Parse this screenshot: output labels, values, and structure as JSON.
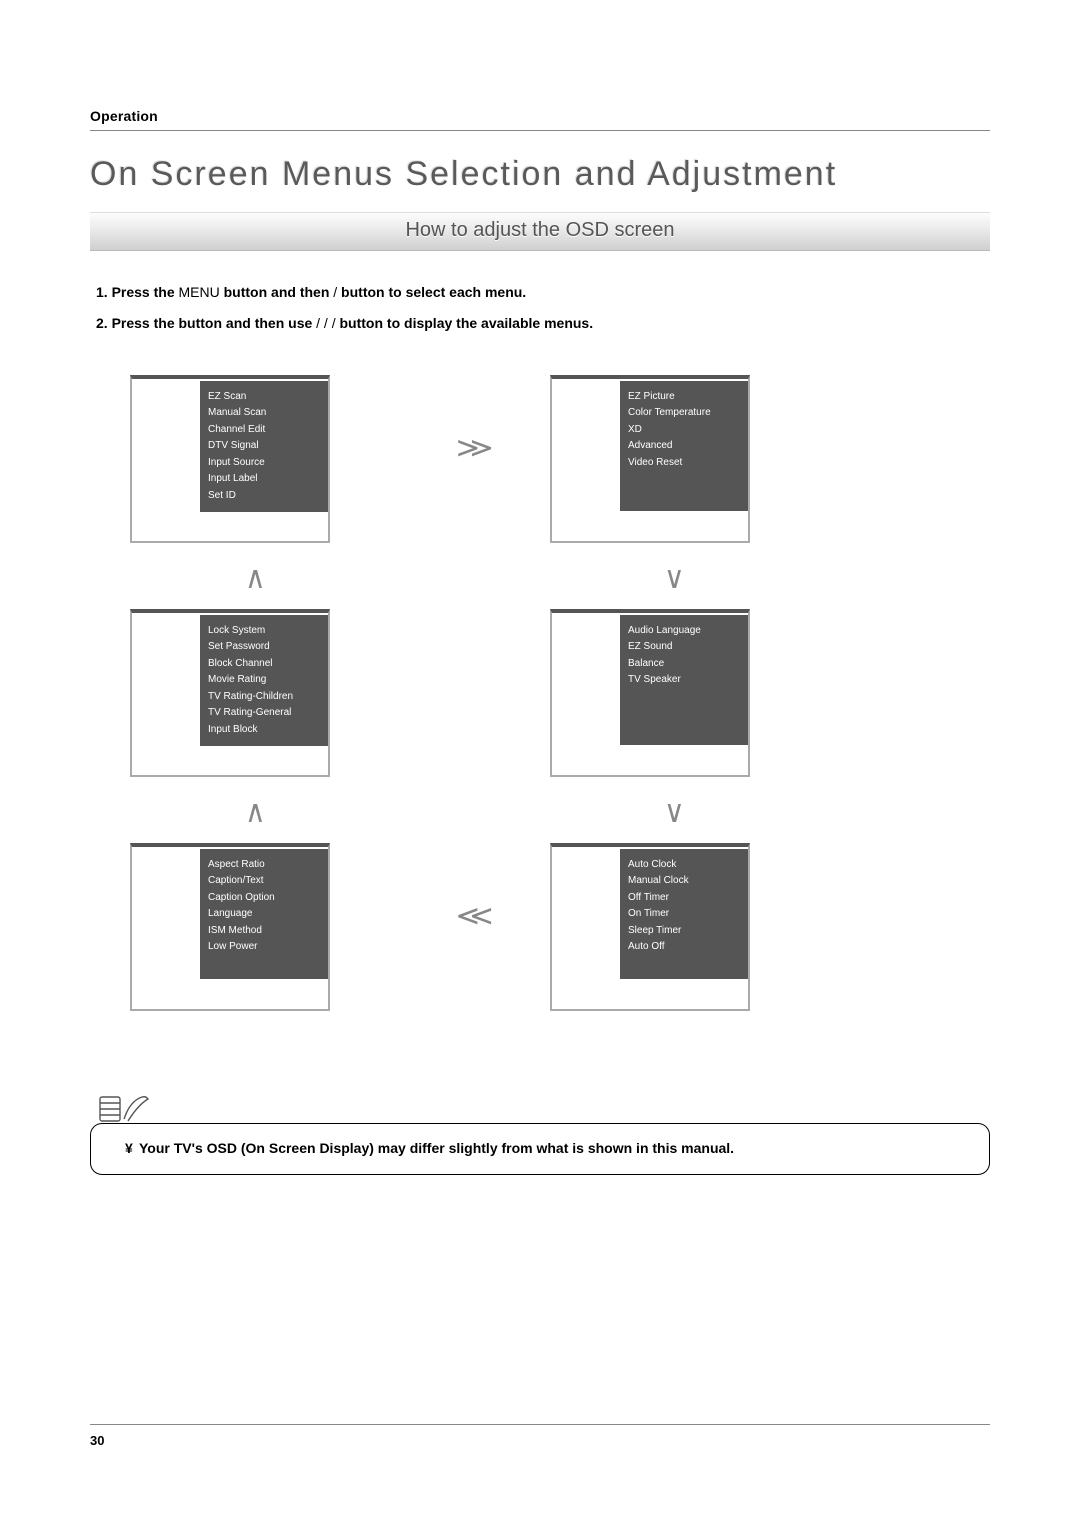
{
  "header": {
    "section": "Operation"
  },
  "title": "On Screen Menus Selection and Adjustment",
  "subtitle": "How to adjust the OSD screen",
  "instructions": {
    "line1_a": "1. Press the ",
    "line1_menu": "MENU",
    "line1_b": " button and then ",
    "line1_slash": "     /     ",
    "line1_c": " button to select each menu.",
    "line2_a": "2. Press the ",
    "line2_b": " button and then use ",
    "line2_slash": "    /    /    /    ",
    "line2_c": " button to display the available menus."
  },
  "menus": {
    "setup": [
      "EZ Scan",
      "Manual Scan",
      "Channel Edit",
      "DTV Signal",
      "Input Source",
      "Input Label",
      "Set ID"
    ],
    "video": [
      "EZ Picture",
      "Color Temperature",
      "XD",
      "Advanced",
      "Video Reset"
    ],
    "lock": [
      "Lock System",
      "Set Password",
      "Block Channel",
      "Movie Rating",
      "TV Rating-Children",
      "TV Rating-General",
      "Input Block"
    ],
    "audio": [
      "Audio Language",
      "EZ Sound",
      "Balance",
      "TV Speaker"
    ],
    "option": [
      "Aspect Ratio",
      "Caption/Text",
      "Caption Option",
      "Language",
      "ISM Method",
      "Low Power"
    ],
    "timer": [
      "Auto Clock",
      "Manual Clock",
      "Off Timer",
      "On Timer",
      "Sleep Timer",
      "Auto Off"
    ]
  },
  "arrows": {
    "right": "≫",
    "left": "≪",
    "up": "∧",
    "down": "∨"
  },
  "note": {
    "bullet": "¥",
    "text": "Your TV's OSD (On Screen Display) may differ slightly from what is shown in this manual."
  },
  "page_number": "30"
}
